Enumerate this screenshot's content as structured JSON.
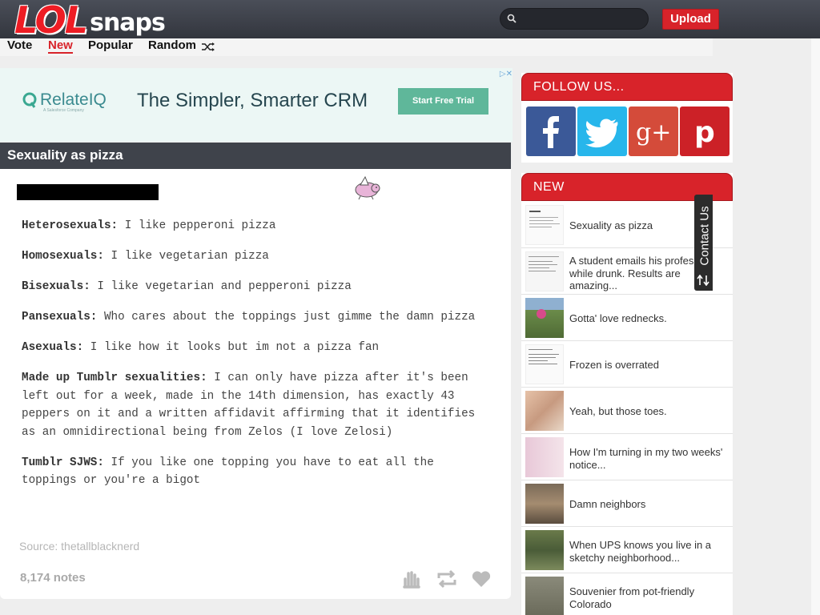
{
  "header": {
    "logo_lol": "LOL",
    "logo_snaps": "snaps",
    "search_placeholder": "",
    "upload_label": "Upload"
  },
  "nav": {
    "items": [
      "Vote",
      "New",
      "Popular",
      "Random"
    ],
    "active": "New"
  },
  "ad": {
    "brand": "RelateIQ",
    "brand_sub": "A Salesforce Company",
    "headline": "The Simpler, Smarter CRM",
    "cta": "Start Free Trial"
  },
  "post": {
    "title": "Sexuality as pizza",
    "lines": [
      {
        "label": "Heterosexuals:",
        "text": " I like pepperoni pizza"
      },
      {
        "label": "Homosexuals:",
        "text": " I like vegetarian pizza"
      },
      {
        "label": "Bisexuals:",
        "text": " I like vegetarian and pepperoni pizza"
      },
      {
        "label": "Pansexuals:",
        "text": " Who cares about the toppings just gimme the damn pizza"
      },
      {
        "label": "Asexuals:",
        "text": " I like how it looks but im not a pizza fan"
      },
      {
        "label": "Made up Tumblr sexualities:",
        "text": " I can only have pizza after it's been left out for a week, made in the 14th dimension, has exactly 43 peppers on it and a written affidavit affirming that it identifies as an omnidirectional being from Zelos (I love Zelosi)"
      },
      {
        "label": "Tumblr SJWS:",
        "text": " If you like one topping you have to eat all the toppings or you're a bigot"
      }
    ],
    "source": "Source: thetallblacknerd",
    "notes": "8,174 notes"
  },
  "sidebar": {
    "follow_title": "FOLLOW US...",
    "new_title": "NEW",
    "social": [
      {
        "name": "facebook",
        "color": "#3b5998",
        "glyph": "f"
      },
      {
        "name": "twitter",
        "color": "#27b6eb",
        "glyph": "t"
      },
      {
        "name": "google-plus",
        "color": "#d44b3a",
        "glyph": "g+"
      },
      {
        "name": "pinterest",
        "color": "#cc2127",
        "glyph": "p"
      }
    ],
    "new_items": [
      "Sexuality as pizza",
      "A student emails his professor while drunk. Results are amazing...",
      "Gotta' love rednecks.",
      "Frozen is overrated",
      "Yeah, but those toes.",
      "How I'm turning in my two weeks' notice...",
      "Damn neighbors",
      "When UPS knows you live in a sketchy neighborhood...",
      "Souvenier from pot-friendly Colorado"
    ]
  },
  "contact": {
    "label": "Contact Us"
  },
  "colors": {
    "brand_red": "#d8232a",
    "header_dark": "#3f434b",
    "ad_bg": "#ecf7f5",
    "ad_green": "#5fb79a"
  }
}
